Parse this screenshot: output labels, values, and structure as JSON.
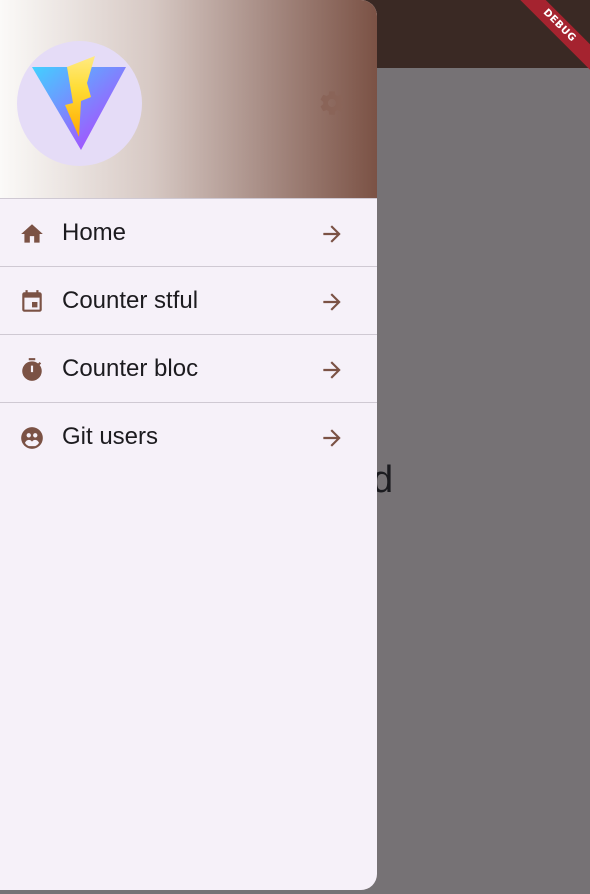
{
  "background": {
    "visible_text": "d"
  },
  "debug_banner": "DEBUG",
  "drawer": {
    "items": [
      {
        "label": "Home",
        "icon": "home-icon"
      },
      {
        "label": "Counter stful",
        "icon": "calendar-icon"
      },
      {
        "label": "Counter bloc",
        "icon": "timer-icon"
      },
      {
        "label": "Git users",
        "icon": "people-icon"
      }
    ]
  },
  "colors": {
    "accent": "#7b5245",
    "drawer_bg": "#f6f1f9",
    "scrim": "#767275",
    "appbar": "#3a2924"
  }
}
